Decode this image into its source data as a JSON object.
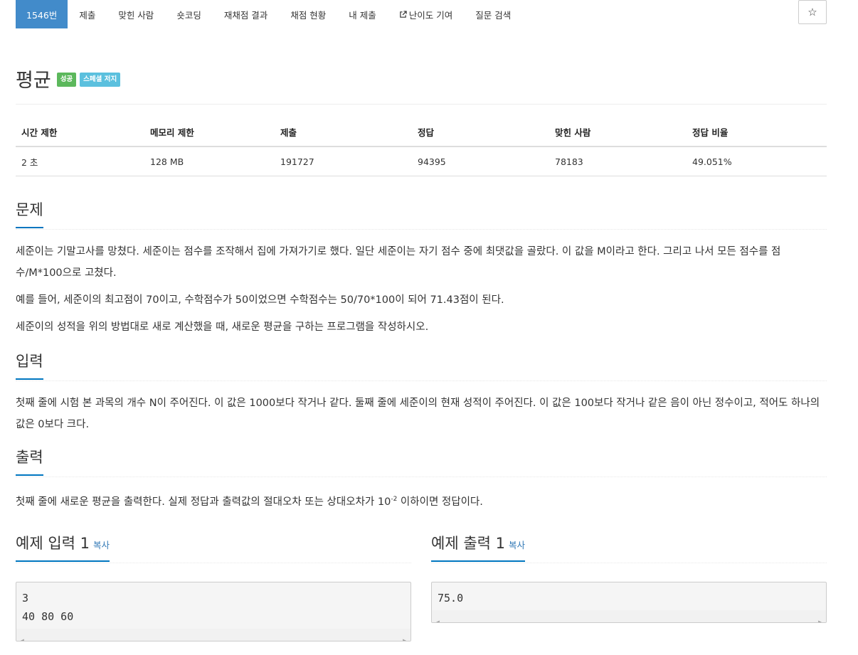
{
  "nav": {
    "tabs": [
      {
        "label": "1546번",
        "active": true
      },
      {
        "label": "제출"
      },
      {
        "label": "맞힌 사람"
      },
      {
        "label": "숏코딩"
      },
      {
        "label": "재채점 결과"
      },
      {
        "label": "채점 현황"
      },
      {
        "label": "내 제출"
      },
      {
        "label": "난이도 기여",
        "icon": "external-link-icon"
      },
      {
        "label": "질문 검색"
      }
    ]
  },
  "problem": {
    "title": "평균",
    "badges": [
      "성공",
      "스페셜 저지"
    ],
    "star_icon": "☆"
  },
  "info_table": {
    "headers": [
      "시간 제한",
      "메모리 제한",
      "제출",
      "정답",
      "맞힌 사람",
      "정답 비율"
    ],
    "values": [
      "2 초",
      "128 MB",
      "191727",
      "94395",
      "78183",
      "49.051%"
    ]
  },
  "description": {
    "heading": "문제",
    "paragraphs": [
      "세준이는 기말고사를 망쳤다. 세준이는 점수를 조작해서 집에 가져가기로 했다. 일단 세준이는 자기 점수 중에 최댓값을 골랐다. 이 값을 M이라고 한다. 그리고 나서 모든 점수를 점수/M*100으로 고쳤다.",
      "예를 들어, 세준이의 최고점이 70이고, 수학점수가 50이었으면 수학점수는 50/70*100이 되어 71.43점이 된다.",
      "세준이의 성적을 위의 방법대로 새로 계산했을 때, 새로운 평균을 구하는 프로그램을 작성하시오."
    ]
  },
  "input": {
    "heading": "입력",
    "text": "첫째 줄에 시험 본 과목의 개수 N이 주어진다. 이 값은 1000보다 작거나 같다. 둘째 줄에 세준이의 현재 성적이 주어진다. 이 값은 100보다 작거나 같은 음이 아닌 정수이고, 적어도 하나의 값은 0보다 크다."
  },
  "output": {
    "heading": "출력",
    "text_before": "첫째 줄에 새로운 평균을 출력한다. 실제 정답과 출력값의 절대오차 또는 상대오차가 10",
    "exponent": "-2",
    "text_after": " 이하이면 정답이다."
  },
  "samples": {
    "input": {
      "title": "예제 입력 1",
      "copy": "복사",
      "data": "3\n40 80 60"
    },
    "output": {
      "title": "예제 출력 1",
      "copy": "복사",
      "data": "75.0"
    }
  }
}
